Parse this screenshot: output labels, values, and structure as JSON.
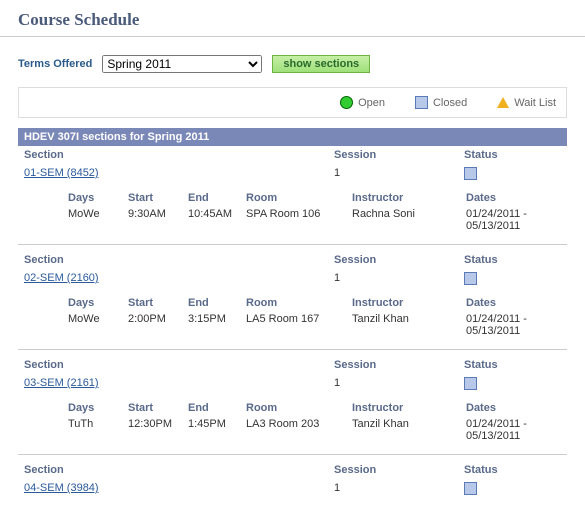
{
  "page_title": "Course Schedule",
  "terms_label": "Terms Offered",
  "term_selected": "Spring 2011",
  "show_btn": "show sections",
  "legend": {
    "open": "Open",
    "closed": "Closed",
    "wait": "Wait List"
  },
  "bar": "HDEV 307I sections for Spring 2011",
  "cols": {
    "section": "Section",
    "session": "Session",
    "status": "Status",
    "days": "Days",
    "start": "Start",
    "end": "End",
    "room": "Room",
    "instructor": "Instructor",
    "dates": "Dates"
  },
  "sections": [
    {
      "link": "01-SEM (8452)",
      "session": "1",
      "days": "MoWe",
      "start": "9:30AM",
      "end": "10:45AM",
      "room": "SPA  Room 106",
      "instructor": "Rachna Soni",
      "dates": "01/24/2011 - 05/13/2011"
    },
    {
      "link": "02-SEM (2160)",
      "session": "1",
      "days": "MoWe",
      "start": "2:00PM",
      "end": "3:15PM",
      "room": "LA5  Room 167",
      "instructor": "Tanzil Khan",
      "dates": "01/24/2011 - 05/13/2011"
    },
    {
      "link": "03-SEM (2161)",
      "session": "1",
      "days": "TuTh",
      "start": "12:30PM",
      "end": "1:45PM",
      "room": "LA3  Room 203",
      "instructor": "Tanzil Khan",
      "dates": "01/24/2011 - 05/13/2011"
    },
    {
      "link": "04-SEM (3984)",
      "session": "1"
    }
  ]
}
